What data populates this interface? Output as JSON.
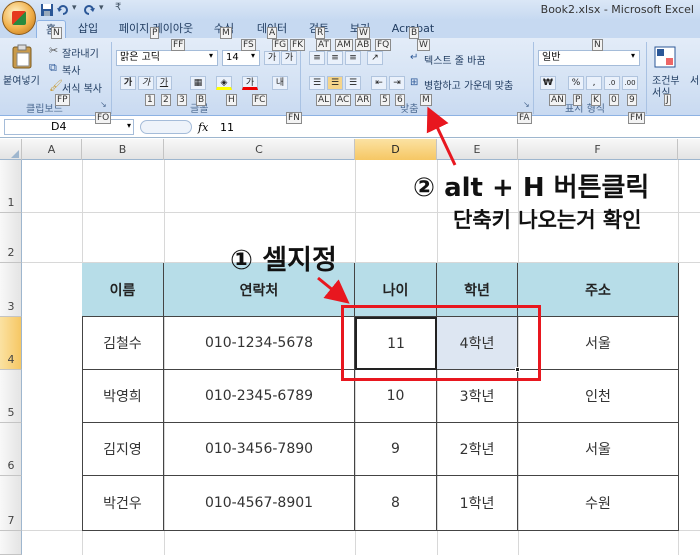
{
  "app": {
    "window_title": "Book2.xlsx - Microsoft Excel",
    "qat_more": "₹"
  },
  "tabs": [
    {
      "label": "홈",
      "keytip": ""
    },
    {
      "label": "삽입",
      "keytip": "N"
    },
    {
      "label": "페이지 레이아웃",
      "keytip": "P"
    },
    {
      "label": "수식",
      "keytip": "M"
    },
    {
      "label": "데이터",
      "keytip": "A"
    },
    {
      "label": "검토",
      "keytip": "R"
    },
    {
      "label": "보기",
      "keytip": "W"
    },
    {
      "label": "Acrobat",
      "keytip": "B"
    }
  ],
  "ribbon": {
    "clipboard": {
      "paste": "붙여넣기",
      "cut": "잘라내기",
      "copy": "복사",
      "format_painter": "서식 복사",
      "group": "클립보드"
    },
    "font": {
      "name": "맑은 고딕",
      "size": "14",
      "group": "글꼴"
    },
    "alignment": {
      "wrap": "텍스트 줄 바꿈",
      "merge": "병합하고 가운데 맞춤",
      "group": "맞춤"
    },
    "number": {
      "format": "일반",
      "group": "표시 형식"
    },
    "styles": {
      "conditional": "조건부",
      "format_label": "서식"
    },
    "keytips": [
      "FF",
      "FS",
      "FG",
      "FK",
      "AT",
      "AM",
      "AB",
      "FQ",
      "W",
      "N",
      "FP",
      "1",
      "2",
      "3",
      "B",
      "H",
      "FC",
      "AL",
      "AC",
      "AR",
      "5",
      "6",
      "M",
      "AN",
      "P",
      "K",
      "0",
      "9",
      "FO",
      "FN",
      "FA",
      "FM",
      "J"
    ]
  },
  "formula_bar": {
    "name_box": "D4",
    "fx": "fx",
    "value": "11"
  },
  "columns": [
    "A",
    "B",
    "C",
    "D",
    "E",
    "F"
  ],
  "rows": [
    "1",
    "2",
    "3",
    "4",
    "5",
    "6",
    "7"
  ],
  "table": {
    "headers": [
      "이름",
      "연락처",
      "나이",
      "학년",
      "주소"
    ],
    "rows": [
      [
        "김철수",
        "010-1234-5678",
        "11",
        "4학년",
        "서울"
      ],
      [
        "박영희",
        "010-2345-6789",
        "10",
        "3학년",
        "인천"
      ],
      [
        "김지영",
        "010-3456-7890",
        "9",
        "2학년",
        "서울"
      ],
      [
        "박건우",
        "010-4567-8901",
        "8",
        "1학년",
        "수원"
      ]
    ]
  },
  "annotations": {
    "step1": "① 셀지정",
    "step2": "② alt + H 버튼클릭",
    "step3": "단축키 나오는거 확인"
  },
  "colors": {
    "header_fill": "#b7dde8",
    "highlight": "#e8171f",
    "selected_header": "#f6c764"
  }
}
